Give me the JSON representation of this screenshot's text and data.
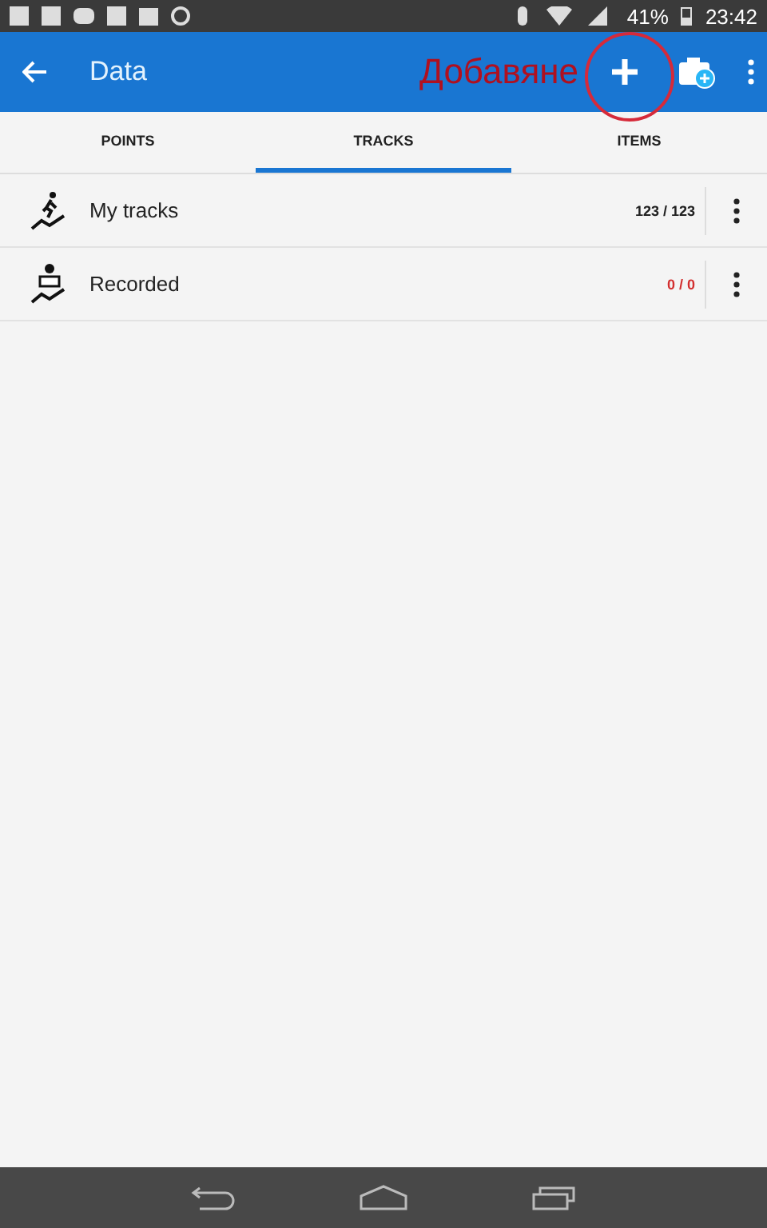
{
  "status_bar": {
    "battery": "41%",
    "time": "23:42"
  },
  "app_bar": {
    "title": "Data",
    "annotation": "Добавяне"
  },
  "tabs": [
    {
      "label": "POINTS",
      "selected": false
    },
    {
      "label": "TRACKS",
      "selected": true
    },
    {
      "label": "ITEMS",
      "selected": false
    }
  ],
  "rows": [
    {
      "kind": "tracks",
      "name": "My tracks",
      "count": "123 / 123",
      "color": "#212121"
    },
    {
      "kind": "recorded",
      "name": "Recorded",
      "count": "0 / 0",
      "color": "#d32f2f"
    }
  ]
}
